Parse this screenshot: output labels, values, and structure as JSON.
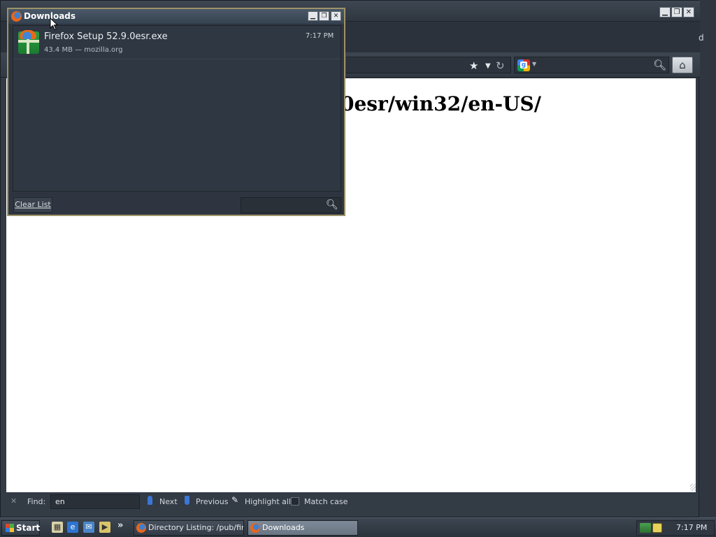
{
  "browser": {
    "stray_text": "d",
    "content": {
      "heading": "0esr/win32/en-US/"
    },
    "toolbar": {
      "bookmark_icon": "star-icon",
      "dropdown_icon": "chevron-down-icon",
      "reload_icon": "reload-icon",
      "search_engine_icon": "google-icon",
      "search_go_icon": "magnifier-icon",
      "home_icon": "home-icon"
    }
  },
  "findbar": {
    "label": "Find:",
    "value": "en",
    "next_label": "Next",
    "previous_label": "Previous",
    "highlight_label": "Highlight all",
    "match_case_label": "Match case",
    "match_case_checked": false
  },
  "downloads": {
    "title": "Downloads",
    "items": [
      {
        "filename": "Firefox Setup 52.9.0esr.exe",
        "details": "43.4 MB — mozilla.org",
        "time": "7:17 PM"
      }
    ],
    "clear_label": "Clear List",
    "search_placeholder": ""
  },
  "taskbar": {
    "start_label": "Start",
    "quick_launch_more": "»",
    "tasks": [
      {
        "label": "Directory Listing: /pub/fir...",
        "active": false
      },
      {
        "label": "Downloads",
        "active": true
      }
    ],
    "clock": "7:17 PM"
  },
  "colors": {
    "chrome_dark": "#333b45",
    "dialog_border": "#9d9367",
    "active_task": "#7d8a98"
  }
}
